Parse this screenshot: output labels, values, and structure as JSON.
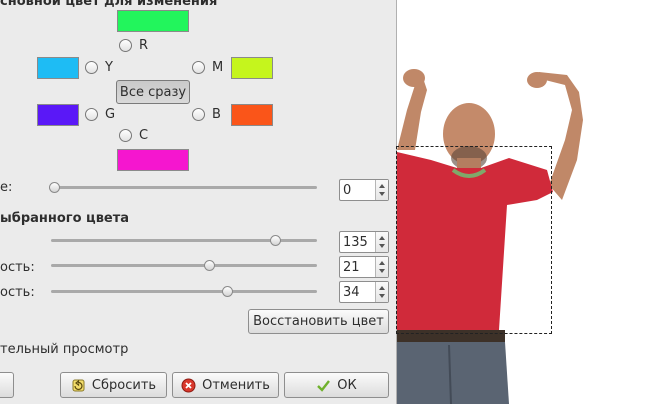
{
  "header": {
    "title_fragment": "сновной цвет для изменения"
  },
  "channels": {
    "R": {
      "label": "R",
      "color": "#22f55c"
    },
    "Y": {
      "label": "Y",
      "color": "#1ebcf4"
    },
    "M": {
      "label": "M",
      "color": "#c5f51d"
    },
    "G": {
      "label": "G",
      "color": "#5a18f7"
    },
    "B": {
      "label": "B",
      "color": "#fa5519"
    },
    "C": {
      "label": "C",
      "color": "#f516cf"
    }
  },
  "all_at_once_button": "Все сразу",
  "overlap": {
    "label_fragment": "е:",
    "value": "0",
    "fraction": 0.0
  },
  "adjust_section": {
    "title_fragment": "ыбранного цвета"
  },
  "sliders": [
    {
      "label_fragment": "",
      "value": "135",
      "fraction": 0.86
    },
    {
      "label_fragment": "ость:",
      "value": "21",
      "fraction": 0.6
    },
    {
      "label_fragment": "ость:",
      "value": "34",
      "fraction": 0.67
    }
  ],
  "reset_color_button": "Восстановить цвет",
  "preview": {
    "label_fragment": "тельный просмотр"
  },
  "footer": {
    "reset_label": "Сбросить",
    "cancel_label": "Отменить",
    "ok_label": "ОК"
  },
  "colors": {
    "dialog_bg": "#ebebeb",
    "shirt": "#d02a3a",
    "skin": "#c08868",
    "jeans": "#5a6472"
  }
}
